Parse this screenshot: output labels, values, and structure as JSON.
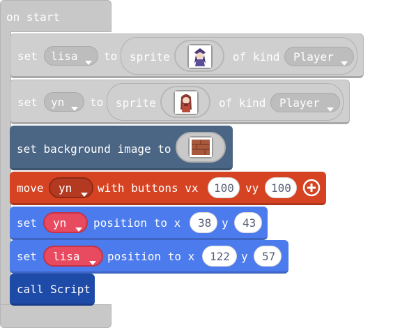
{
  "blocks": {
    "on_start": {
      "label": "on start"
    },
    "set_lisa": {
      "set": "set",
      "var": "lisa",
      "to": "to",
      "sprite": "sprite",
      "of_kind": "of kind",
      "kind": "Player"
    },
    "set_yn": {
      "set": "set",
      "var": "yn",
      "to": "to",
      "sprite": "sprite",
      "of_kind": "of kind",
      "kind": "Player"
    },
    "background": {
      "label": "set background image to"
    },
    "move": {
      "move": "move",
      "var": "yn",
      "with": "with buttons vx",
      "vx": "100",
      "vy_label": "vy",
      "vy": "100"
    },
    "pos_yn": {
      "set": "set",
      "var": "yn",
      "label": "position to x",
      "x": "38",
      "y_label": "y",
      "y": "43"
    },
    "pos_lisa": {
      "set": "set",
      "var": "lisa",
      "label": "position to x",
      "x": "122",
      "y_label": "y",
      "y": "57"
    },
    "call": {
      "label": "call Script"
    }
  },
  "colors": {
    "hat": "#c8c8c8",
    "sprite_block": "#cfcfcf",
    "scene_block": "#4b6584",
    "controller_block": "#d54322",
    "sprite_var_block": "#4b7bec",
    "variable_dd": "#e84a5f",
    "function_block": "#1e4aa8",
    "text_grey": "#ffffff"
  },
  "icons": [
    "dropdown-arrow",
    "plus-circle-icon",
    "sprite-lisa-image",
    "sprite-yn-image",
    "brick-image"
  ]
}
